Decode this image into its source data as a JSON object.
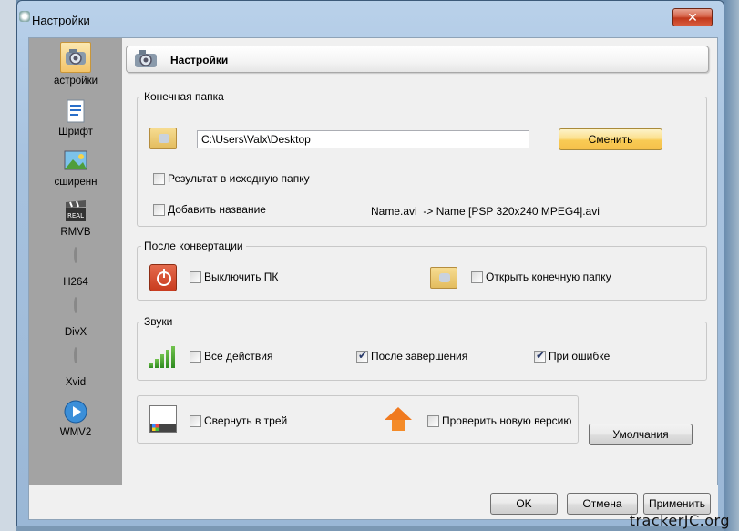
{
  "window": {
    "title": "Настройки",
    "close_glyph": "✕"
  },
  "sidebar": {
    "items": [
      {
        "label": "астройки",
        "icon": "settings-camera-icon"
      },
      {
        "label": "Шрифт",
        "icon": "font-document-icon"
      },
      {
        "label": "сширенн",
        "icon": "image-landscape-icon"
      },
      {
        "label": "RMVB",
        "icon": "real-media-clapper-icon"
      },
      {
        "label": "H264",
        "icon": "film-reel-icon"
      },
      {
        "label": "DivX",
        "icon": "film-reel-icon"
      },
      {
        "label": "Xvid",
        "icon": "film-reel-icon"
      },
      {
        "label": "WMV2",
        "icon": "windows-media-icon"
      }
    ]
  },
  "header": {
    "title": "Настройки"
  },
  "output_folder": {
    "legend": "Конечная папка",
    "path_value": "C:\\Users\\Valx\\Desktop",
    "change_label": "Сменить",
    "result_to_source_label": "Результат в исходную папку",
    "result_to_source_checked": false,
    "add_name_label": "Добавить название",
    "add_name_checked": false,
    "name_example": "Name.avi  -> Name [PSP 320x240 MPEG4].avi"
  },
  "after_conversion": {
    "legend": "После конвертации",
    "shutdown_label": "Выключить ПК",
    "shutdown_checked": false,
    "open_folder_label": "Открыть конечную папку",
    "open_folder_checked": false
  },
  "sounds": {
    "legend": "Звуки",
    "all_actions_label": "Все действия",
    "all_actions_checked": false,
    "after_finish_label": "После завершения",
    "after_finish_checked": true,
    "on_error_label": "При ошибке",
    "on_error_checked": true
  },
  "misc": {
    "minimize_tray_label": "Свернуть в трей",
    "minimize_tray_checked": false,
    "check_update_label": "Проверить новую версию",
    "check_update_checked": false
  },
  "buttons": {
    "defaults": "Умолчания",
    "ok": "OK",
    "cancel": "Отмена",
    "apply": "Применить"
  },
  "watermark": "trackerJC.org"
}
